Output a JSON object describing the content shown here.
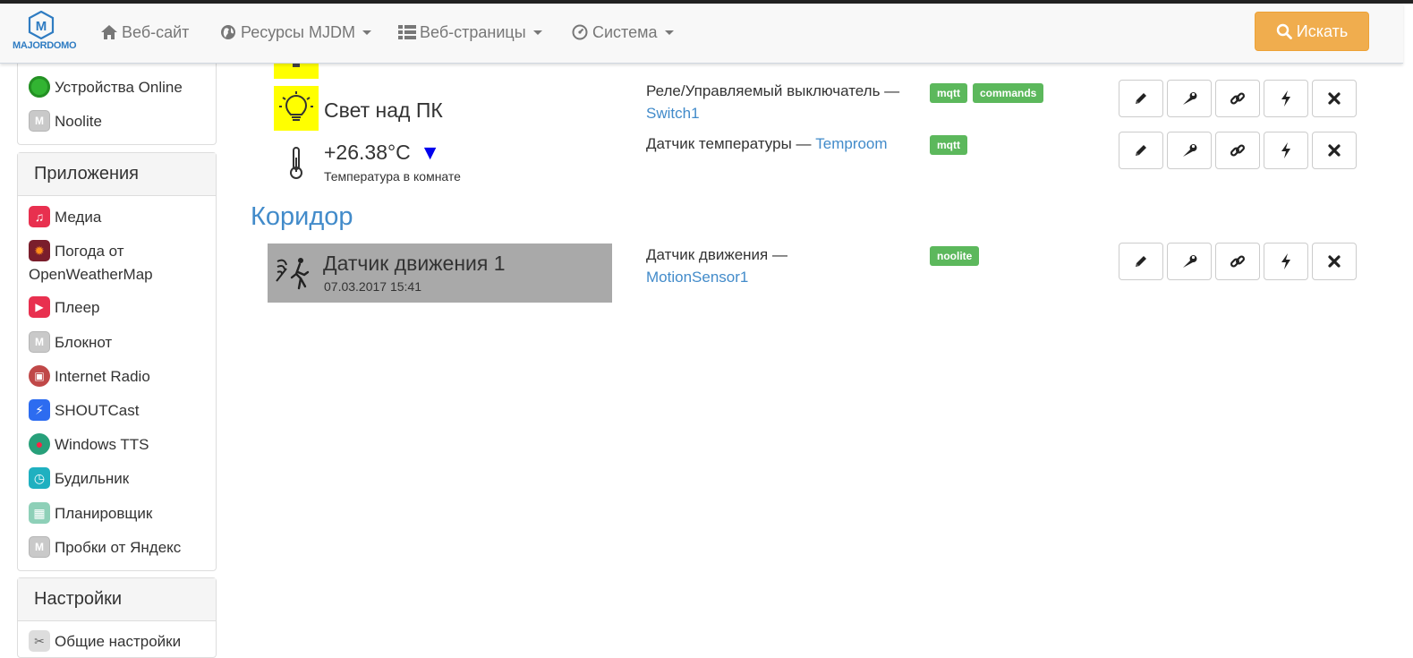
{
  "navbar": {
    "logo_text": "MAJORDOMO",
    "items": [
      {
        "label": "Веб-сайт",
        "icon": "home-icon",
        "has_caret": false
      },
      {
        "label": "Ресурсы MJDM",
        "icon": "globe-icon",
        "has_caret": true
      },
      {
        "label": "Веб-страницы",
        "icon": "list-icon",
        "has_caret": true
      },
      {
        "label": "Система",
        "icon": "dashboard-icon",
        "has_caret": true
      }
    ],
    "search_label": "Искать",
    "search_color": "#f0ad4e"
  },
  "sidebar": {
    "top_items": [
      {
        "label": "Устройства Online",
        "icon": "green-dot-icon"
      },
      {
        "label": "Noolite",
        "icon": "majordomo-gray-icon"
      }
    ],
    "apps_heading": "Приложения",
    "apps": [
      {
        "label": "Медиа",
        "icon": "music-icon"
      },
      {
        "label": "Погода от OpenWeatherMap",
        "icon": "sun-icon"
      },
      {
        "label": "Плеер",
        "icon": "play-icon"
      },
      {
        "label": "Блокнот",
        "icon": "majordomo-gray-icon"
      },
      {
        "label": "Internet Radio",
        "icon": "radio-icon"
      },
      {
        "label": "SHOUTCast",
        "icon": "shoutcast-icon"
      },
      {
        "label": "Windows TTS",
        "icon": "microphone-icon"
      },
      {
        "label": "Будильник",
        "icon": "alarm-clock-icon"
      },
      {
        "label": "Планировщик",
        "icon": "calendar-icon"
      },
      {
        "label": "Пробки от Яндекс",
        "icon": "majordomo-gray-icon"
      }
    ],
    "settings_heading": "Настройки",
    "settings_items": [
      {
        "label": "Общие настройки",
        "icon": "tools-icon"
      }
    ]
  },
  "main": {
    "devices": [
      {
        "title": "Свет над ПК",
        "subtitle": "",
        "icon": "lightbulb-icon",
        "type_text": "Реле/Управляемый выключатель —",
        "type_link": "Switch1",
        "tags": [
          "mqtt",
          "commands"
        ]
      },
      {
        "title": "+26.38°C",
        "trend": "▼",
        "subtitle": "Температура в комнате",
        "icon": "thermometer-icon",
        "type_text": "Датчик температуры —",
        "type_link": "Temproom",
        "tags": [
          "mqtt"
        ]
      }
    ],
    "section_title": "Коридор",
    "motion_device": {
      "title": "Датчик движения 1",
      "subtitle": "07.03.2017 15:41",
      "icon": "motion-sensor-icon",
      "type_text": "Датчик движения —",
      "type_link": "MotionSensor1",
      "tags": [
        "noolite"
      ]
    },
    "action_buttons": [
      "edit-icon",
      "wrench-icon",
      "link-icon",
      "bolt-icon",
      "close-icon"
    ],
    "tag_color": "#5cb85c",
    "link_color": "#428bca"
  }
}
